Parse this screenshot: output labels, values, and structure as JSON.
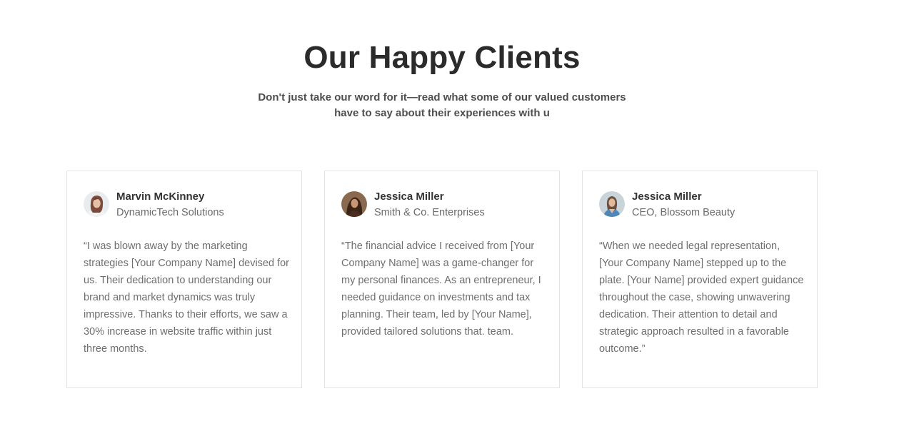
{
  "section": {
    "title": "Our Happy Clients",
    "subtitle_line1": "Don't just take our word for it—read what some of our valued customers",
    "subtitle_line2": "have to say about their experiences with u"
  },
  "testimonials": [
    {
      "name": "Marvin McKinney",
      "company": "DynamicTech Solutions",
      "quote": "“I was blown away by the marketing strategies [Your Company Name] devised for us. Their dedication to understanding our brand and market dynamics was truly impressive. Thanks to their efforts, we saw a 30% increase in website traffic within just three months.",
      "avatar_icon": "avatar-photo"
    },
    {
      "name": "Jessica Miller",
      "company": "Smith & Co. Enterprises",
      "quote": "“The financial advice I received from [Your Company Name] was a game-changer for my personal finances. As an entrepreneur, I needed guidance on investments and tax planning. Their team, led by [Your Name], provided tailored solutions that. team.",
      "avatar_icon": "avatar-photo"
    },
    {
      "name": "Jessica Miller",
      "company": "CEO, Blossom Beauty",
      "quote": "“When we needed legal representation, [Your Company Name] stepped up to the plate. [Your Name] provided expert guidance throughout the case, showing unwavering dedication. Their attention to detail and strategic approach resulted in a favorable outcome.”",
      "avatar_icon": "avatar-photo"
    }
  ],
  "colors": {
    "heading": "#2b2b2b",
    "subtitle": "#4e4e4e",
    "body_text": "#6e6e6e",
    "card_border": "#e4e4e4"
  }
}
